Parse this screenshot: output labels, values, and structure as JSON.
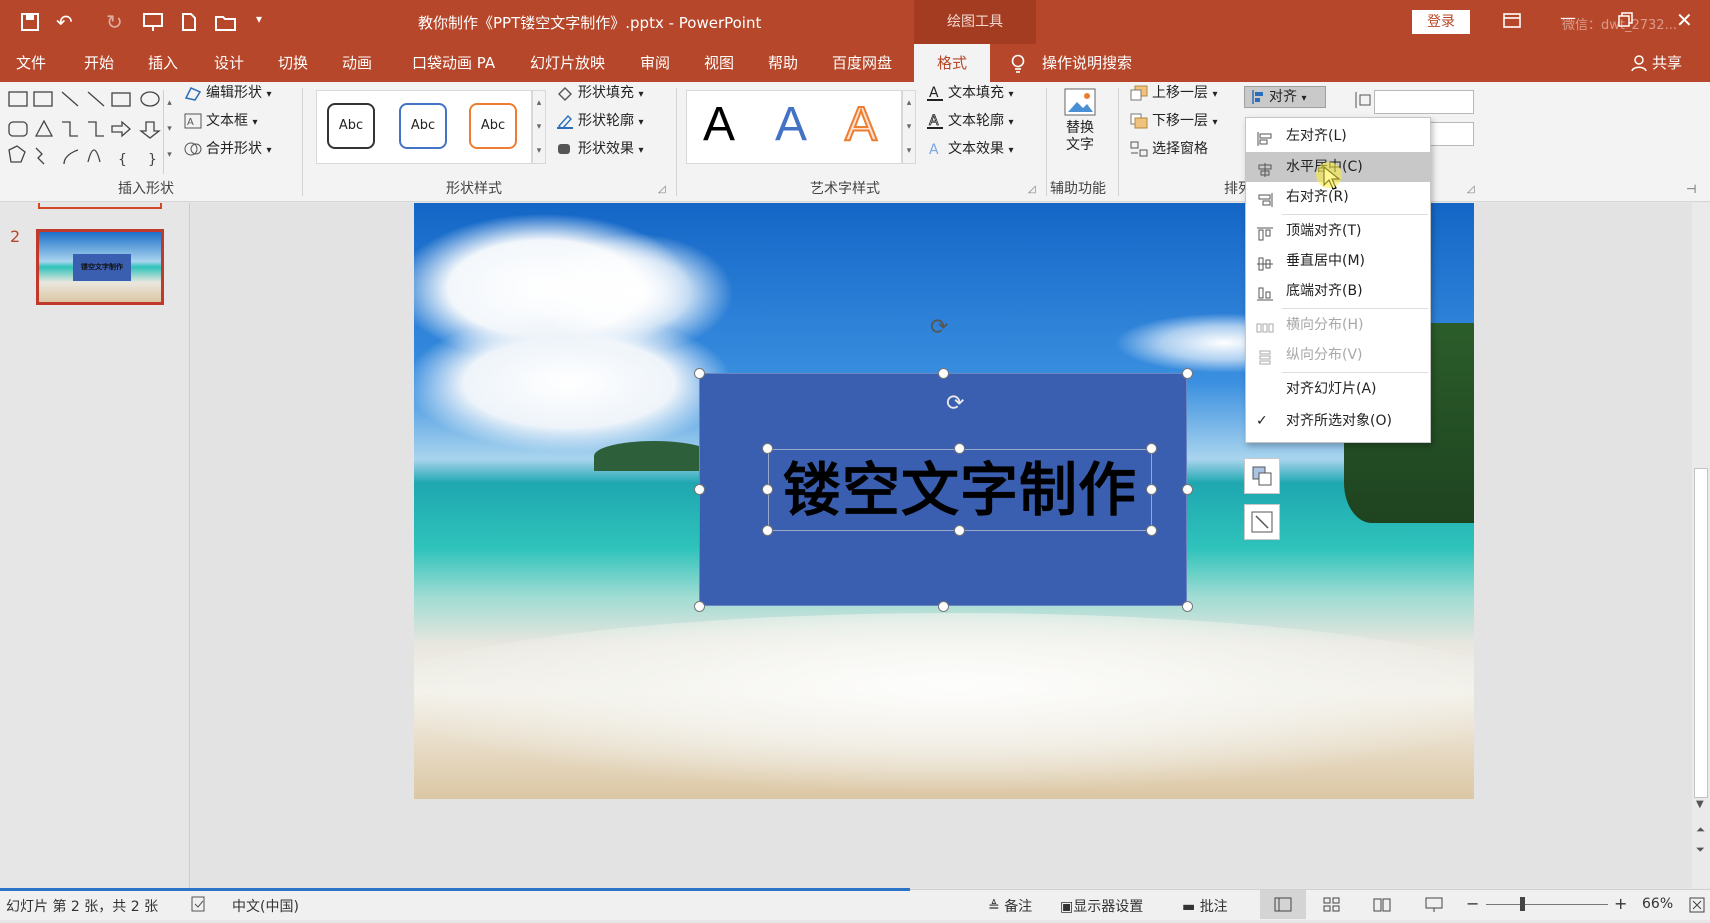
{
  "titlebar": {
    "title": "教你制作《PPT镂空文字制作》.pptx  -  PowerPoint",
    "context_tab": "绘图工具",
    "login": "登录",
    "user_watermark": "微信：dwt_2732..."
  },
  "tabs": [
    {
      "label": "文件"
    },
    {
      "label": "开始"
    },
    {
      "label": "插入"
    },
    {
      "label": "设计"
    },
    {
      "label": "切换"
    },
    {
      "label": "动画"
    },
    {
      "label": "口袋动画 PA"
    },
    {
      "label": "幻灯片放映"
    },
    {
      "label": "审阅"
    },
    {
      "label": "视图"
    },
    {
      "label": "帮助"
    },
    {
      "label": "百度网盘"
    },
    {
      "label": "格式"
    }
  ],
  "tell_me": "操作说明搜索",
  "share": "共享",
  "ribbon": {
    "insert_shapes": {
      "label": "插入形状",
      "edit_shape": "编辑形状",
      "text_box": "文本框",
      "merge_shapes": "合并形状"
    },
    "shape_styles": {
      "label": "形状样式",
      "samples": [
        "Abc",
        "Abc",
        "Abc"
      ],
      "fill": "形状填充",
      "outline": "形状轮廓",
      "effects": "形状效果"
    },
    "wordart": {
      "label": "艺术字样式",
      "letters": [
        "A",
        "A",
        "A"
      ],
      "text_fill": "文本填充",
      "text_outline": "文本轮廓",
      "text_effects": "文本效果"
    },
    "accessibility": {
      "label": "辅助功能",
      "alt_text": "替换\n文字"
    },
    "arrange": {
      "label": "排列",
      "bring_forward": "上移一层",
      "send_backward": "下移一层",
      "selection_pane": "选择窗格",
      "align": "对齐"
    }
  },
  "align_menu": [
    {
      "label": "左对齐(L)",
      "state": "normal"
    },
    {
      "label": "水平居中(C)",
      "state": "hover"
    },
    {
      "label": "右对齐(R)",
      "state": "normal"
    },
    {
      "label": "顶端对齐(T)",
      "state": "normal"
    },
    {
      "label": "垂直居中(M)",
      "state": "normal"
    },
    {
      "label": "底端对齐(B)",
      "state": "normal"
    },
    {
      "label": "横向分布(H)",
      "state": "disabled"
    },
    {
      "label": "纵向分布(V)",
      "state": "disabled"
    },
    {
      "label": "对齐幻灯片(A)",
      "state": "normal"
    },
    {
      "label": "对齐所选对象(O)",
      "state": "checked"
    }
  ],
  "thumbnail": {
    "number": "2",
    "caption": "镂空文字制作"
  },
  "slide": {
    "text": "镂空文字制作"
  },
  "status": {
    "slide_info": "幻灯片 第 2 张，共 2 张",
    "language": "中文(中国)",
    "notes": "备注",
    "display_settings": "显示器设置",
    "comments": "批注",
    "zoom": "66%"
  },
  "colors": {
    "accent": "#b7472a",
    "box_fill": "#3b5fb0"
  }
}
